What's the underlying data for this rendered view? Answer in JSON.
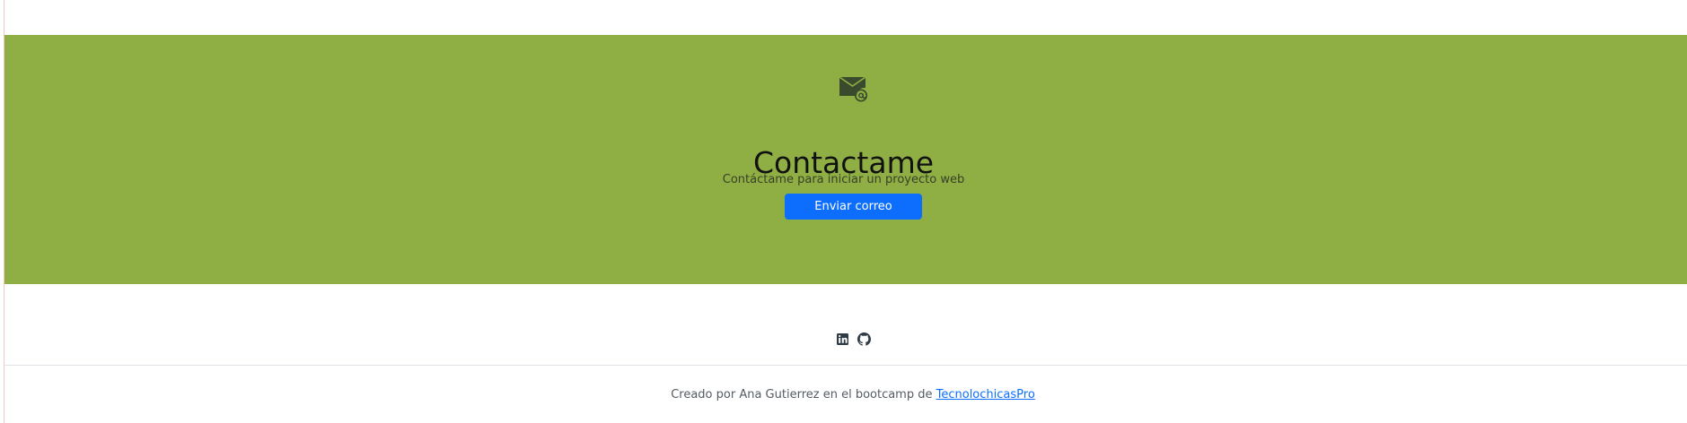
{
  "contact": {
    "icon": "envelope-at-icon",
    "title": "Contactame",
    "subtitle": "Contáctame para iniciar un proyecto web",
    "button_label": "Enviar correo",
    "background_color": "#8faf44",
    "button_color": "#0d6efd"
  },
  "footer": {
    "social_icons": [
      "linkedin-icon",
      "github-icon"
    ],
    "credits_text": "Creado por Ana Gutierrez en el bootcamp de ",
    "credits_link": "TecnolochicasPro",
    "link_color": "#0d6efd"
  }
}
